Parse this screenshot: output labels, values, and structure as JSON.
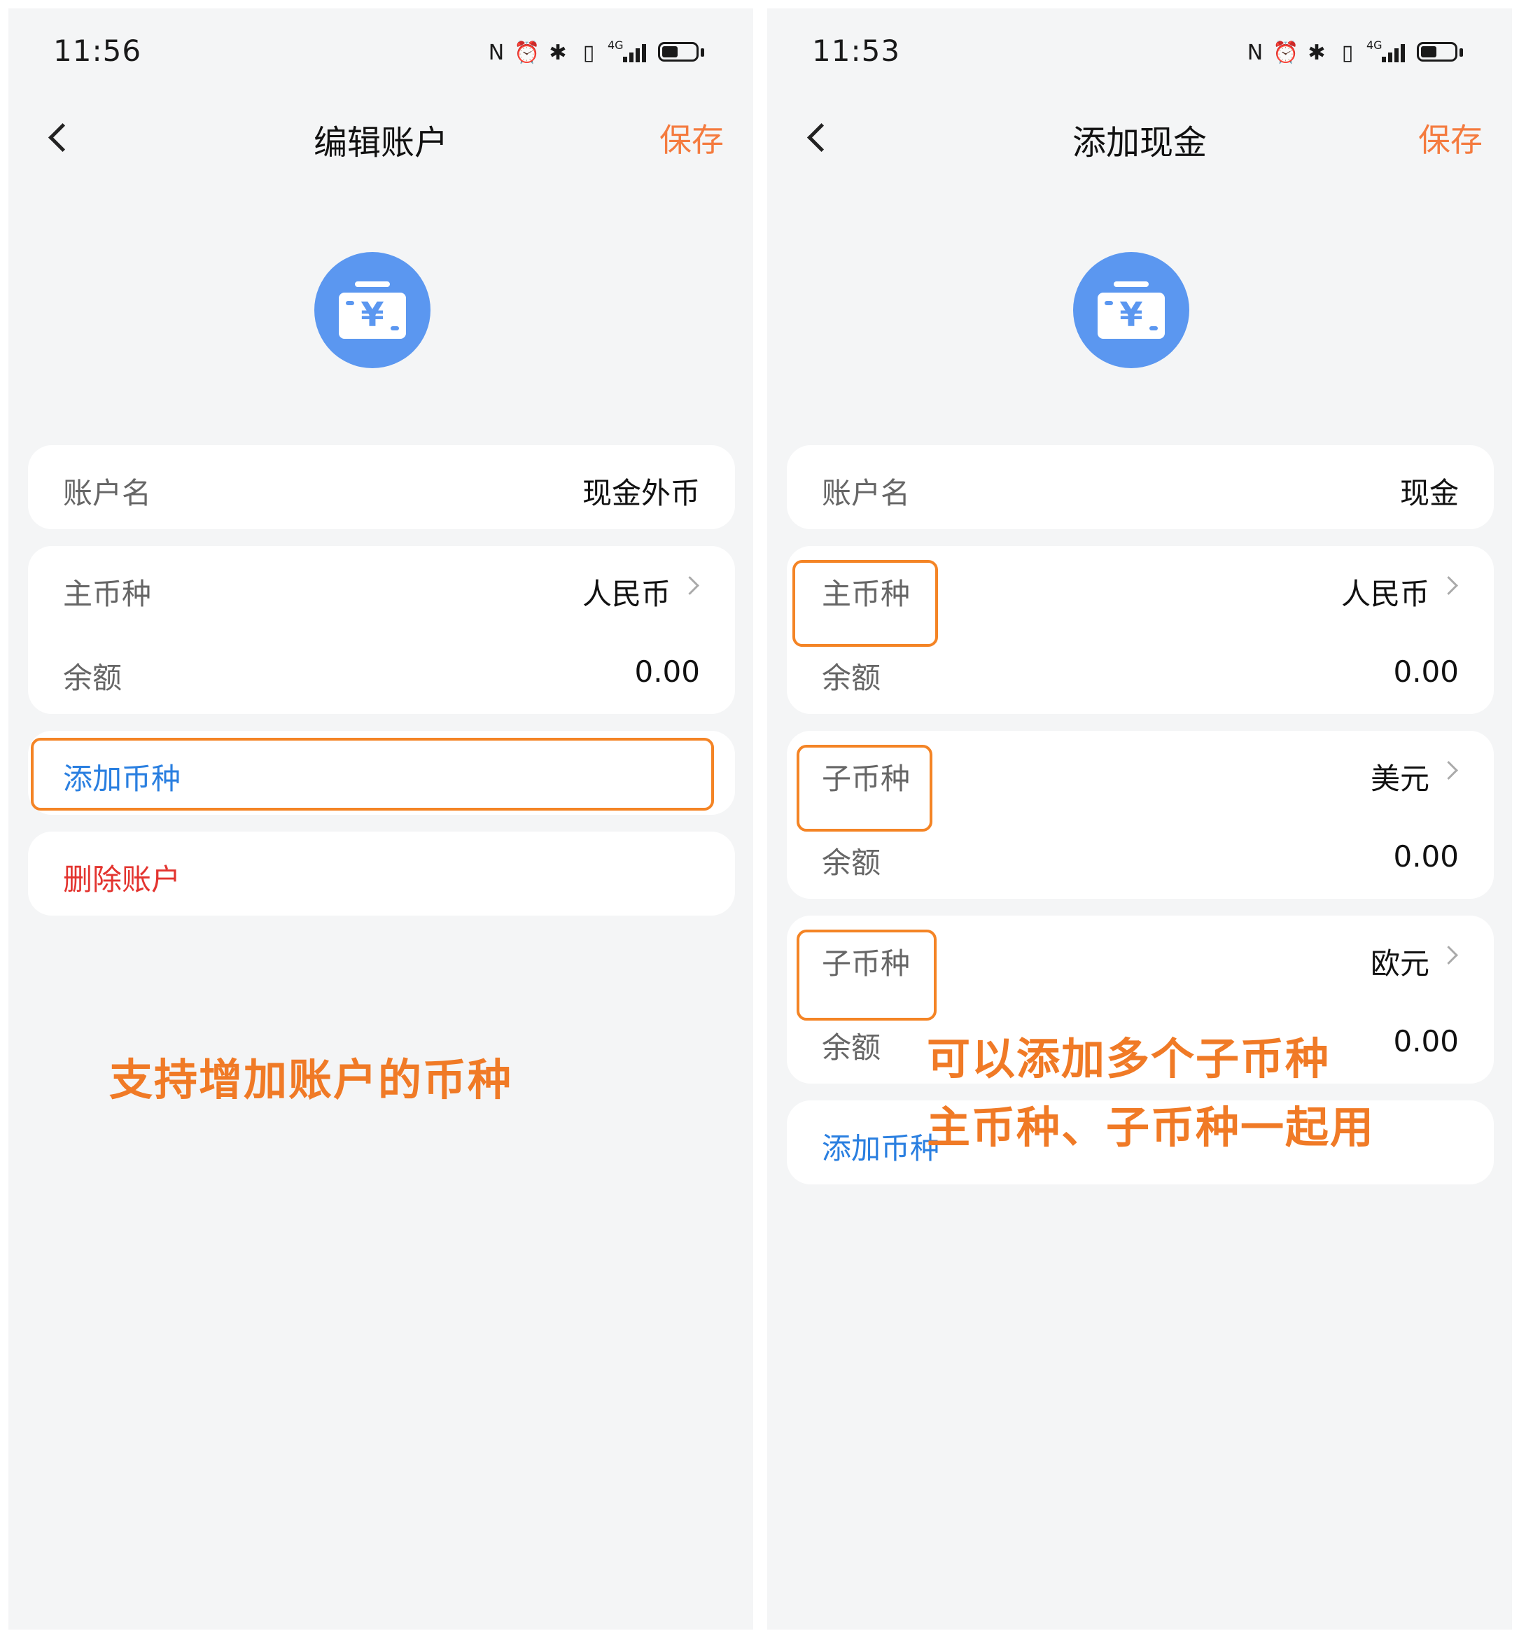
{
  "left_screen": {
    "status": {
      "time": "11:56"
    },
    "nav": {
      "title": "编辑账户",
      "save_label": "保存"
    },
    "account_name": {
      "label": "账户名",
      "value": "现金外币"
    },
    "primary_currency": {
      "label": "主币种",
      "value": "人民币"
    },
    "balance": {
      "label": "余额",
      "value": "0.00"
    },
    "add_currency_label": "添加币种",
    "delete_account_label": "删除账户",
    "annotation": "支持增加账户的币种"
  },
  "right_screen": {
    "status": {
      "time": "11:53"
    },
    "nav": {
      "title": "添加现金",
      "save_label": "保存"
    },
    "account_name": {
      "label": "账户名",
      "value": "现金"
    },
    "primary_currency": {
      "label": "主币种",
      "value": "人民币",
      "balance_label": "余额",
      "balance_value": "0.00"
    },
    "sub_currencies": [
      {
        "label": "子币种",
        "value": "美元",
        "balance_label": "余额",
        "balance_value": "0.00"
      },
      {
        "label": "子币种",
        "value": "欧元",
        "balance_label": "余额",
        "balance_value": "0.00"
      }
    ],
    "add_currency_label": "添加币种",
    "annotation_line1": "可以添加多个子币种",
    "annotation_line2": "主币种、子币种一起用"
  },
  "status_icons": [
    "nfc-icon",
    "alarm-icon",
    "bluetooth-icon",
    "vibrate-icon",
    "4g-signal-icon",
    "battery-icon"
  ],
  "icons": {
    "account": "wallet-yen-icon",
    "back": "chevron-left-icon",
    "row": "chevron-right-icon"
  },
  "colors": {
    "accent": "#f47b3f",
    "link": "#2a7fe0",
    "danger": "#e3342f",
    "icon_bg": "#5b97f0",
    "highlight": "#f48425",
    "background": "#f4f5f6",
    "card": "#ffffff"
  }
}
